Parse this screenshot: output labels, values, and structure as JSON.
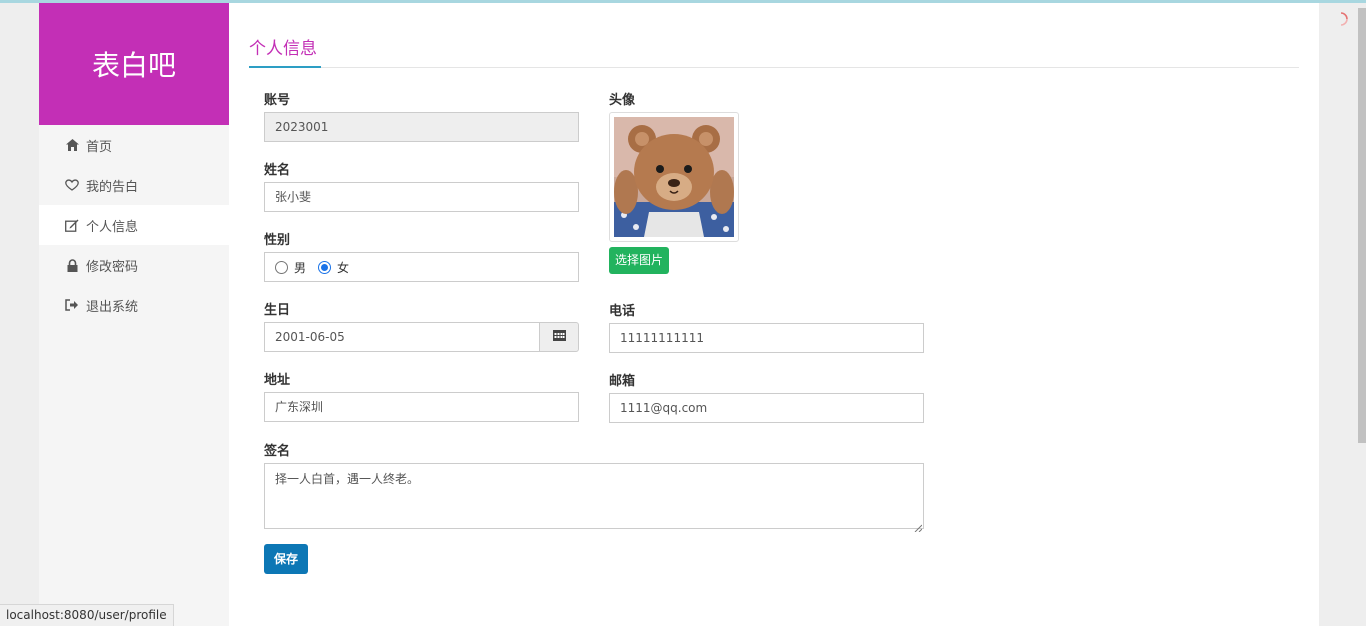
{
  "sidebar": {
    "brand": "表白吧",
    "items": [
      {
        "label": "首页",
        "icon": "home-icon"
      },
      {
        "label": "我的告白",
        "icon": "heart-icon"
      },
      {
        "label": "个人信息",
        "icon": "edit-icon",
        "active": true
      },
      {
        "label": "修改密码",
        "icon": "lock-icon"
      },
      {
        "label": "退出系统",
        "icon": "sign-out-icon"
      }
    ]
  },
  "page": {
    "title": "个人信息"
  },
  "form": {
    "account_label": "账号",
    "account_value": "2023001",
    "name_label": "姓名",
    "name_value": "张小斐",
    "gender_label": "性别",
    "gender_options": [
      "男",
      "女"
    ],
    "gender_selected": "女",
    "birthday_label": "生日",
    "birthday_value": "2001-06-05",
    "address_label": "地址",
    "address_value": "广东深圳",
    "avatar_label": "头像",
    "choose_image_label": "选择图片",
    "phone_label": "电话",
    "phone_value": "11111111111",
    "email_label": "邮箱",
    "email_value": "1111@qq.com",
    "signature_label": "签名",
    "signature_value": "择一人白首，遇一人终老。",
    "save_label": "保存"
  },
  "status_bar": {
    "url": "localhost:8080/user/profile"
  },
  "colors": {
    "brand": "#c32fb6",
    "title_underline": "#2d9ec4",
    "choose_button": "#22b35e",
    "save_button": "#0d77b5"
  }
}
